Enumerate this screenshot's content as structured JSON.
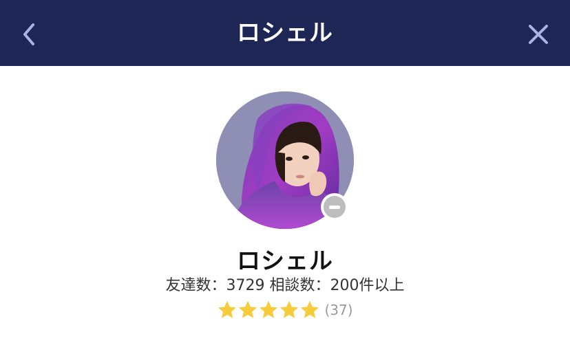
{
  "header": {
    "title": "ロシェル",
    "back_icon": "chevron-left-icon",
    "close_icon": "close-icon",
    "background_color": "#1e2656"
  },
  "profile": {
    "name": "ロシェル",
    "friends_label": "友達数：",
    "friends_count": "3729",
    "consult_label": "相談数：",
    "consult_count": "200件以上",
    "status_icon": "status-away-icon"
  },
  "rating": {
    "stars": 5,
    "count_text": "(37)",
    "star_color": "#f6cc3c"
  }
}
